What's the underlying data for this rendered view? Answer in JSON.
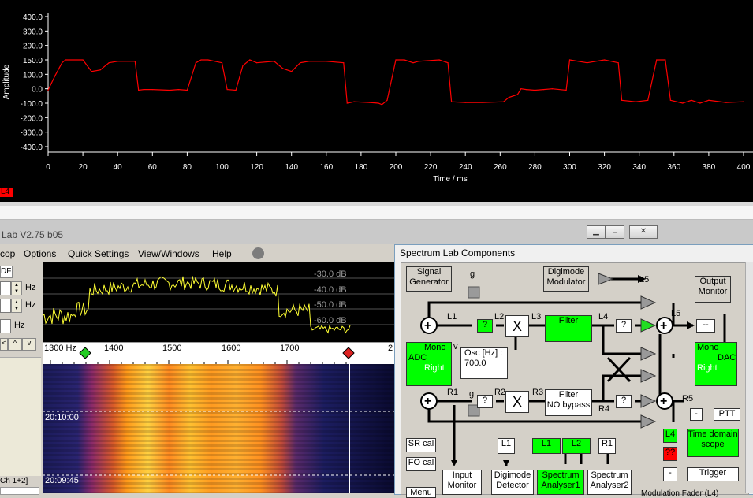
{
  "scope": {
    "y_ticks": [
      "400.0",
      "300.0",
      "200.0",
      "150.0",
      "100.0",
      "0.0",
      "-100.0",
      "-200.0",
      "-300.0",
      "-400.0"
    ],
    "x_ticks": [
      "0",
      "20",
      "40",
      "60",
      "80",
      "100",
      "120",
      "140",
      "160",
      "180",
      "200",
      "220",
      "240",
      "260",
      "280",
      "300",
      "320",
      "340",
      "360",
      "380",
      "400"
    ],
    "ylabel": "Amplitude",
    "xlabel": "Time / ms",
    "channel_tag": "L4",
    "trace_color": "#ff0000"
  },
  "chart_data": {
    "type": "line",
    "xlabel": "Time / ms",
    "ylabel": "Amplitude",
    "xlim": [
      0,
      400
    ],
    "ylim": [
      -400,
      400
    ],
    "y_tick_values": [
      400,
      300,
      200,
      150,
      100,
      0,
      -100,
      -200,
      -300,
      -400
    ],
    "grid": false,
    "series": [
      {
        "color": "#ff0000",
        "x": [
          0,
          2,
          4,
          8,
          10,
          20,
          25,
          30,
          35,
          40,
          50,
          52,
          55,
          60,
          70,
          75,
          80,
          85,
          88,
          92,
          100,
          103,
          108,
          112,
          116,
          120,
          130,
          135,
          140,
          145,
          150,
          160,
          170,
          172,
          176,
          185,
          190,
          192,
          195,
          200,
          205,
          210,
          213,
          225,
          230,
          232,
          240,
          250,
          262,
          265,
          270,
          272,
          275,
          280,
          285,
          290,
          298,
          300,
          310,
          320,
          328,
          330,
          338,
          345,
          350,
          355,
          358,
          365,
          370,
          375,
          380,
          390,
          400
        ],
        "y": [
          -10,
          40,
          90,
          140,
          150,
          150,
          110,
          115,
          140,
          145,
          145,
          -10,
          -5,
          -5,
          -10,
          -5,
          -10,
          140,
          150,
          150,
          140,
          -5,
          -10,
          130,
          150,
          140,
          145,
          120,
          110,
          140,
          145,
          145,
          140,
          -100,
          -90,
          -95,
          -100,
          -110,
          -80,
          150,
          150,
          140,
          145,
          150,
          140,
          -90,
          -95,
          -95,
          -90,
          -60,
          -40,
          0,
          -5,
          -10,
          -5,
          0,
          -10,
          150,
          140,
          150,
          140,
          -80,
          -90,
          -80,
          150,
          150,
          -80,
          -100,
          -80,
          -100,
          -80,
          -95,
          -90
        ]
      }
    ]
  },
  "spectrum_window": {
    "title": "Lab V2.75 b05",
    "menu": [
      "cop",
      "Options",
      "Quick Settings",
      "View/Windows",
      "Help"
    ],
    "controls": {
      "tab_label": "DF",
      "hz1": "Hz",
      "hz2": "Hz",
      "hz3": "Hz",
      "btn_left": "<",
      "btn_a": "^",
      "btn_v": "v",
      "channel": "Ch 1+2]"
    },
    "db_labels": [
      "-30.0 dB",
      "-40.0 dB",
      "-50.0 dB",
      "-60.0 dB"
    ],
    "freq_labels": [
      "1300 Hz",
      "1400",
      "1500",
      "1600",
      "1700",
      "2"
    ],
    "times": [
      "20:10:00",
      "20:09:45"
    ]
  },
  "components": {
    "title": "Spectrum Lab  Components",
    "signal_generator": "Signal\nGenerator",
    "digimode_modulator": "Digimode\nModulator",
    "output_monitor": "Output\nMonitor",
    "adc": {
      "mono": "Mono",
      "adc": "ADC",
      "right": "Right"
    },
    "dac": {
      "mono": "Mono",
      "dac": "DAC",
      "right": "Right"
    },
    "filter": "Filter",
    "filter_nobypass": "Filter\nNO bypass",
    "osc": "Osc [Hz] :\n700.0",
    "question": "?",
    "x": "X",
    "nodes": [
      "L1",
      "L2",
      "L3",
      "L4",
      "L5",
      "R1",
      "R2",
      "R3",
      "R4",
      "R5"
    ],
    "g": "g",
    "v": "v",
    "dashes": "--",
    "minus": "-",
    "ptt": "PTT",
    "trigger": "Trigger",
    "time_domain_scope": "Time domain\nscope",
    "scope_tag_l4": "L4",
    "scope_tag_q": "??",
    "sr_cal": "SR cal",
    "fo_cal": "FO cal",
    "menu_btn": "Menu",
    "input_monitor": "Input\nMonitor",
    "digimode_detector": "Digimode\nDetector",
    "spectrum_analyser1": "Spectrum\nAnalyser1",
    "spectrum_analyser2": "Spectrum\nAnalyser2",
    "bottom_tags": [
      "L1",
      "L1",
      "L2",
      "R1"
    ],
    "modulation_text": "Modulation Fader (L4)"
  },
  "colors": {
    "active_green": "#00ff00",
    "trace_red": "#ff0000",
    "spectrum_yellow": "#ffff33"
  }
}
